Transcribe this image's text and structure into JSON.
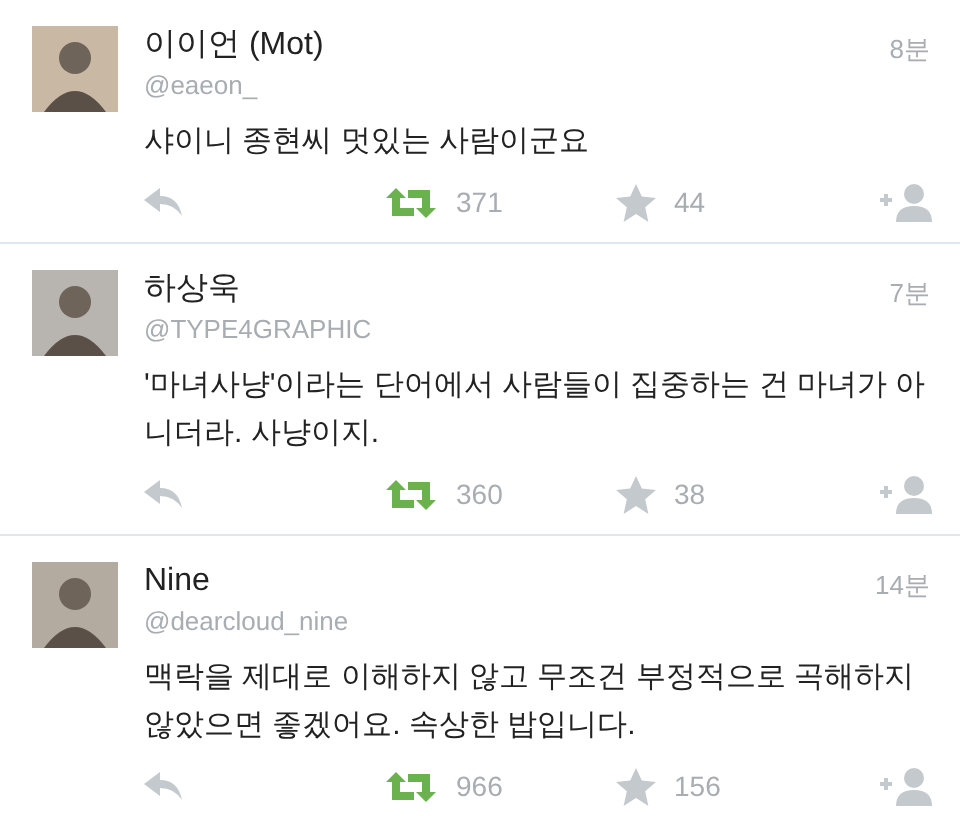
{
  "tweets": [
    {
      "name": "이이언 (Mot)",
      "handle": "@eaeon_",
      "time": "8분",
      "text": "샤이니 종현씨 멋있는 사람이군요",
      "retweeted": true,
      "retweets": "371",
      "favorited": false,
      "favorites": "44"
    },
    {
      "name": "하상욱",
      "handle": "@TYPE4GRAPHIC",
      "time": "7분",
      "text": "'마녀사냥'이라는 단어에서 사람들이 집중하는 건 마녀가 아니더라. 사냥이지.",
      "retweeted": true,
      "retweets": "360",
      "favorited": false,
      "favorites": "38"
    },
    {
      "name": "Nine",
      "handle": "@dearcloud_nine",
      "time": "14분",
      "text": "맥락을 제대로 이해하지 않고 무조건 부정적으로 곡해하지 않았으면 좋겠어요. 속상한 밥입니다.",
      "retweeted": true,
      "retweets": "966",
      "favorited": false,
      "favorites": "156"
    }
  ]
}
